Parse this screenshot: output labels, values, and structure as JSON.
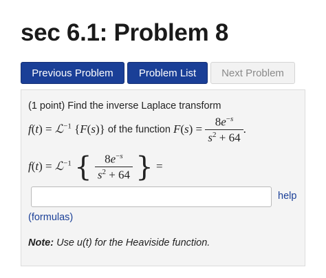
{
  "page": {
    "title": "sec 6.1: Problem 8"
  },
  "nav": {
    "previous_label": "Previous Problem",
    "list_label": "Problem List",
    "next_label": "Next Problem"
  },
  "problem": {
    "intro": "(1 point) Find the inverse Laplace transform",
    "mid_text": "of the function",
    "help_label": "help",
    "formulas_label": "(formulas)",
    "note_label": "Note:",
    "note_text": "Use u(t) for the Heaviside function.",
    "answer_value": ""
  }
}
